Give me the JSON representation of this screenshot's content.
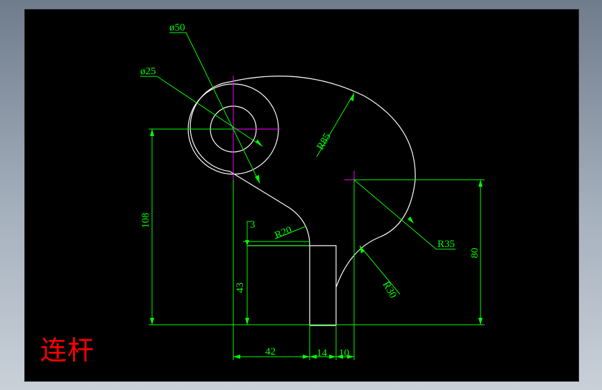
{
  "drawing": {
    "title": "连杆",
    "dimensions": {
      "dia_big": "ø50",
      "dia_small": "ø25",
      "r85": "R85",
      "r20": "R20",
      "r35": "R35",
      "r30": "R30",
      "d3": "3",
      "d108": "108",
      "d43": "43",
      "d80": "80",
      "d42": "42",
      "d14": "14",
      "d10": "10"
    },
    "colors": {
      "background": "#000000",
      "outline": "#ffffff",
      "dimension": "#00ff00",
      "centerline": "#ff00ff",
      "title": "#ff0000"
    }
  }
}
